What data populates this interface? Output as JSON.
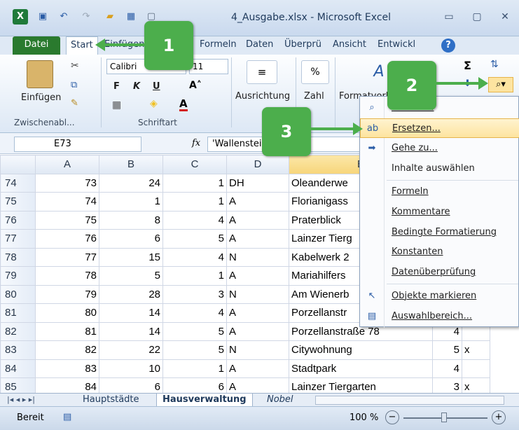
{
  "window": {
    "title": "4_Ausgabe.xlsx - Microsoft Excel"
  },
  "tabs": [
    "Datei",
    "Start",
    "Einfügen",
    "Formeln",
    "Daten",
    "Überprü",
    "Ansicht",
    "Entwickl"
  ],
  "ribbon": {
    "paste_label": "Einfügen",
    "clipboard_group": "Zwischenabl...",
    "font_name": "Calibri",
    "font_size": "11",
    "bold": "F",
    "italic": "K",
    "underline": "U",
    "font_group": "Schriftart",
    "alignment_label": "Ausrichtung",
    "number_label": "Zahl",
    "number_symbol": "%",
    "styles_label": "Formatvorlagen"
  },
  "formula_bar": {
    "name_box": "E73",
    "fx": "fx",
    "value": "'Wallenstein"
  },
  "columns": [
    "A",
    "B",
    "C",
    "D",
    "E"
  ],
  "rows": [
    {
      "row": "74",
      "a": "73",
      "b": "24",
      "c": "1",
      "d": "DH",
      "e": "Oleanderwe"
    },
    {
      "row": "75",
      "a": "74",
      "b": "1",
      "c": "1",
      "d": "A",
      "e": "Florianigass"
    },
    {
      "row": "76",
      "a": "75",
      "b": "8",
      "c": "4",
      "d": "A",
      "e": "Praterblick"
    },
    {
      "row": "77",
      "a": "76",
      "b": "6",
      "c": "5",
      "d": "A",
      "e": "Lainzer Tierg"
    },
    {
      "row": "78",
      "a": "77",
      "b": "15",
      "c": "4",
      "d": "N",
      "e": "Kabelwerk 2"
    },
    {
      "row": "79",
      "a": "78",
      "b": "5",
      "c": "1",
      "d": "A",
      "e": "Mariahilfers"
    },
    {
      "row": "80",
      "a": "79",
      "b": "28",
      "c": "3",
      "d": "N",
      "e": "Am Wienerb"
    },
    {
      "row": "81",
      "a": "80",
      "b": "14",
      "c": "4",
      "d": "A",
      "e": "Porzellanstr"
    },
    {
      "row": "82",
      "a": "81",
      "b": "14",
      "c": "5",
      "d": "A",
      "e": "Porzellanstraße 78"
    },
    {
      "row": "83",
      "a": "82",
      "b": "22",
      "c": "5",
      "d": "N",
      "e": "Citywohnung"
    },
    {
      "row": "84",
      "a": "83",
      "b": "10",
      "c": "1",
      "d": "A",
      "e": "Stadtpark"
    },
    {
      "row": "85",
      "a": "84",
      "b": "6",
      "c": "6",
      "d": "A",
      "e": "Lainzer Tiergarten"
    }
  ],
  "extra_cols": [
    {
      "row": "82",
      "f": "4",
      "g": ""
    },
    {
      "row": "83",
      "f": "5",
      "g": "x"
    },
    {
      "row": "84",
      "f": "4",
      "g": ""
    },
    {
      "row": "85",
      "f": "3",
      "g": "x"
    }
  ],
  "dropdown": {
    "items": [
      "Suchen...",
      "Ersetzen...",
      "Gehe zu...",
      "Inhalte auswählen",
      "Formeln",
      "Kommentare",
      "Bedingte Formatierung",
      "Konstanten",
      "Datenüberprüfung",
      "Objekte markieren",
      "Auswahlbereich..."
    ]
  },
  "sheets": [
    "Hauptstädte",
    "Hausverwaltung",
    "Nobel"
  ],
  "status": {
    "ready": "Bereit",
    "zoom": "100 %"
  },
  "callouts": [
    "1",
    "2",
    "3"
  ],
  "colors": {
    "accent_green": "#4cae4c",
    "file_tab": "#2a7a2e",
    "highlight": "#fde4a0"
  }
}
